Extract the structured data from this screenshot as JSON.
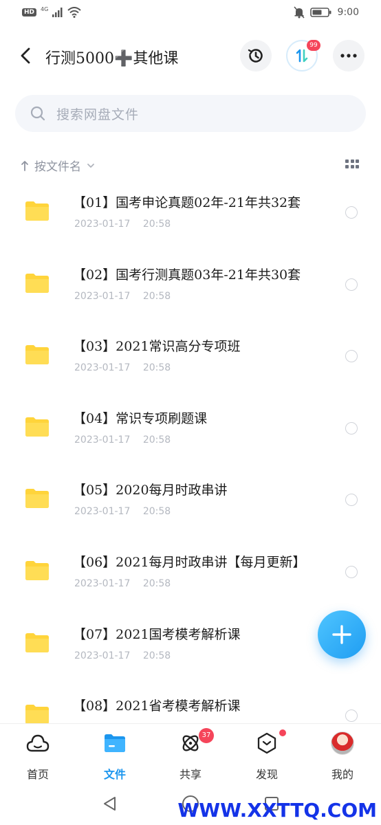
{
  "status_bar": {
    "left_badge": "HD",
    "network": "4G",
    "time": "9:00"
  },
  "header": {
    "title": "行测5000➕其他课",
    "transfer_badge": "99",
    "icons": {
      "back": "back-arrow-icon",
      "history": "history-clock-icon",
      "transfer": "transfer-arrows-icon",
      "more": "more-dots-icon"
    }
  },
  "search": {
    "placeholder": "搜索网盘文件",
    "icon": "search-icon"
  },
  "sort": {
    "label": "按文件名",
    "icon": "sort-arrow-up-icon",
    "view_icon": "grid-view-icon"
  },
  "files": [
    {
      "name": "【01】国考申论真题02年-21年共32套",
      "date": "2023-01-17",
      "time": "20:58"
    },
    {
      "name": "【02】国考行测真题03年-21年共30套",
      "date": "2023-01-17",
      "time": "20:58"
    },
    {
      "name": "【03】2021常识高分专项班",
      "date": "2023-01-17",
      "time": "20:58"
    },
    {
      "name": "【04】常识专项刷题课",
      "date": "2023-01-17",
      "time": "20:58"
    },
    {
      "name": "【05】2020每月时政串讲",
      "date": "2023-01-17",
      "time": "20:58"
    },
    {
      "name": "【06】2021每月时政串讲【每月更新】",
      "date": "2023-01-17",
      "time": "20:58"
    },
    {
      "name": "【07】2021国考模考解析课",
      "date": "2023-01-17",
      "time": "20:58"
    },
    {
      "name": "【08】2021省考模考解析课",
      "date": "",
      "time": ""
    }
  ],
  "bottom_nav": {
    "items": [
      {
        "label": "首页",
        "icon": "home-cloud-icon"
      },
      {
        "label": "文件",
        "icon": "folder-icon",
        "active": true
      },
      {
        "label": "共享",
        "icon": "share-orbit-icon",
        "badge": "37"
      },
      {
        "label": "发现",
        "icon": "discover-cube-icon"
      },
      {
        "label": "我的",
        "icon": "avatar"
      }
    ]
  },
  "watermark": "WWW.XXTTQ.COM",
  "colors": {
    "accent": "#1c96ee",
    "folder": "#ffd43b",
    "badge": "#f5455a",
    "watermark": "#1433e8"
  }
}
